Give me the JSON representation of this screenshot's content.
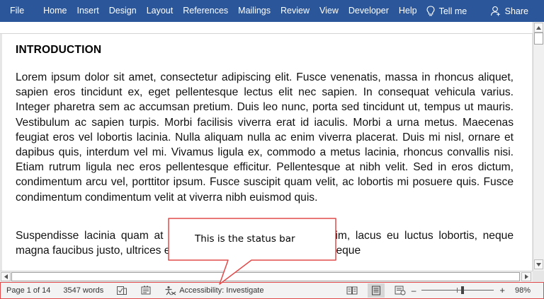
{
  "menu": {
    "items": [
      "File",
      "Home",
      "Insert",
      "Design",
      "Layout",
      "References",
      "Mailings",
      "Review",
      "View",
      "Developer",
      "Help"
    ],
    "tell_me": "Tell me",
    "share": "Share"
  },
  "document": {
    "heading": "INTRODUCTION",
    "paragraphs": [
      "Lorem ipsum dolor sit amet, consectetur adipiscing elit. Fusce venenatis, massa in rhoncus aliquet, sapien eros tincidunt ex, eget pellentesque lectus elit nec sapien. In consequat vehicula varius. Integer pharetra sem ac accumsan pretium. Duis leo nunc, porta sed tincidunt ut, tempus ut mauris. Vestibulum ac sapien turpis. Morbi facilisis viverra erat id iaculis. Morbi a urna metus. Maecenas feugiat eros vel lobortis lacinia. Nulla aliquam nulla ac enim viverra placerat. Duis mi nisl, ornare et dapibus quis, interdum vel mi. Vivamus ligula ex, commodo a metus lacinia, rhoncus convallis nisi. Etiam rutrum ligula nec eros pellentesque efficitur. Pellentesque at nibh velit. Sed in eros dictum, condimentum arcu vel, porttitor ipsum. Fusce suscipit quam velit, ac lobortis mi posuere quis. Fusce condimentum condimentum velit at viverra nibh euismod quis.",
      "Suspendisse lacinia quam at euismod pretium. Nullam dignissim, lacus eu luctus lobortis, neque magna faucibus justo, ultrices elit libero eu ligula. Morbi porttitor neque"
    ]
  },
  "status_bar": {
    "page": "Page 1 of 14",
    "words": "3547 words",
    "accessibility": "Accessibility: Investigate",
    "zoom": "98%",
    "zoom_minus": "–",
    "zoom_plus": "+"
  },
  "callout": {
    "text": "This is the status bar"
  },
  "colors": {
    "ribbon": "#2b579a",
    "callout_border": "#e04a4a"
  }
}
